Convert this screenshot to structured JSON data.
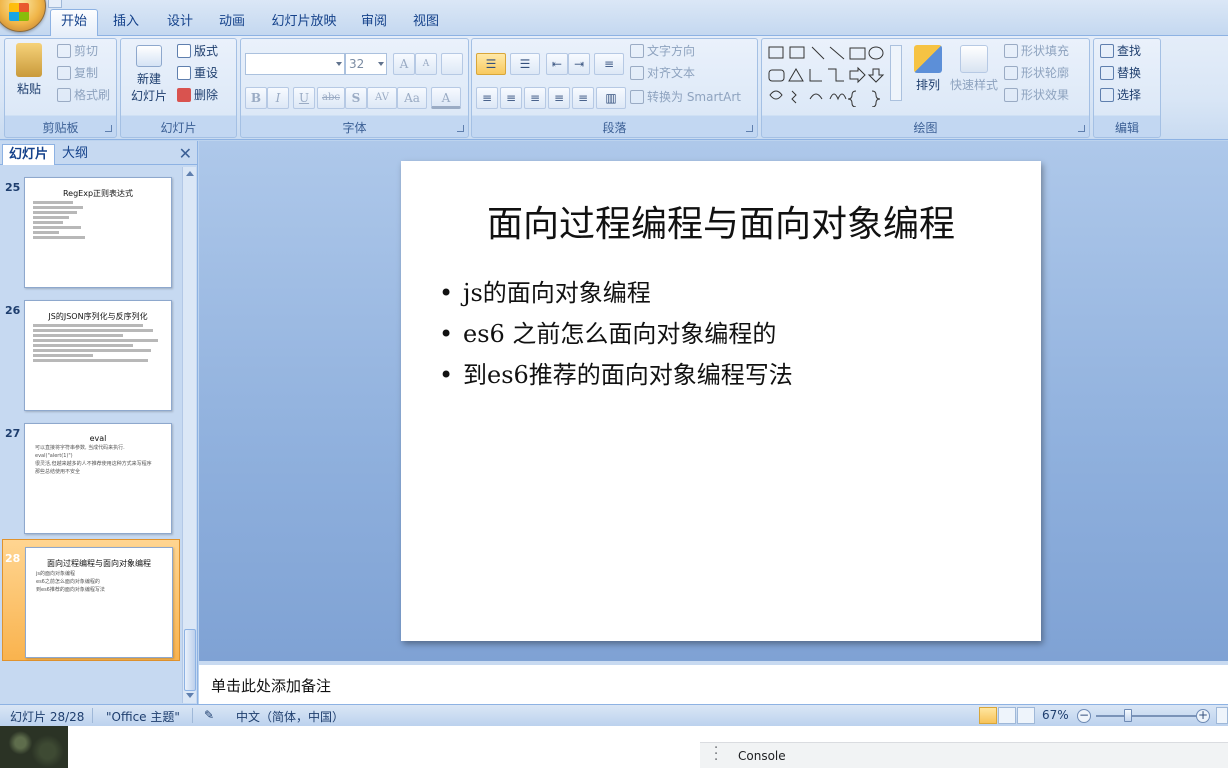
{
  "ribbon_tabs": [
    "开始",
    "插入",
    "设计",
    "动画",
    "幻灯片放映",
    "审阅",
    "视图"
  ],
  "active_tab": "开始",
  "clipboard": {
    "paste": "粘贴",
    "cut": "剪切",
    "copy": "复制",
    "format_painter": "格式刷",
    "label": "剪贴板"
  },
  "slides_group": {
    "new_slide": "新建",
    "new_slide_2": "幻灯片",
    "layout": "版式",
    "reset": "重设",
    "delete": "删除",
    "label": "幻灯片"
  },
  "font": {
    "font_size": "32",
    "bold": "B",
    "italic": "I",
    "underline": "U",
    "strike": "abc",
    "shadow": "S",
    "spacing": "AV",
    "case": "Aa",
    "color": "A",
    "grow": "A",
    "shrink": "A",
    "label": "字体"
  },
  "paragraph": {
    "text_direction": "文字方向",
    "align_text": "对齐文本",
    "smartart": "转换为 SmartArt",
    "label": "段落"
  },
  "drawing": {
    "arrange": "排列",
    "quick_styles": "快速样式",
    "shape_fill": "形状填充",
    "shape_outline": "形状轮廓",
    "shape_effects": "形状效果",
    "label": "绘图"
  },
  "editing": {
    "find": "查找",
    "replace": "替换",
    "select": "选择",
    "label": "编辑"
  },
  "panel_tabs": {
    "slides": "幻灯片",
    "outline": "大纲",
    "close": "✕"
  },
  "thumbnails": [
    {
      "num": "25",
      "title": "RegExp正则表达式"
    },
    {
      "num": "26",
      "title": "JS的JSON序列化与反序列化"
    },
    {
      "num": "27",
      "title": "eval",
      "lines": [
        "可以直接将字符串参数, 当成代码来执行.",
        "eval(\"alert(1)\")",
        "很灵活,但越来越多的人不推荐使用这种方式来写程序",
        "那些总结使用不安全"
      ]
    },
    {
      "num": "28",
      "title": "面向过程编程与面向对象编程",
      "lines": [
        "js的面向对象编程",
        "es6之前怎么面向对象编程的",
        "到es6推荐的面向对象编程写法"
      ]
    }
  ],
  "slide": {
    "title": "面向过程编程与面向对象编程",
    "bullets": [
      "js的面向对象编程",
      "es6 之前怎么面向对象编程的",
      "到es6推荐的面向对象编程写法"
    ]
  },
  "notes_placeholder": "单击此处添加备注",
  "status": {
    "slide_pos": "幻灯片 28/28",
    "theme": "\"Office 主题\"",
    "language": "中文（简体，中国）",
    "zoom": "67%",
    "zoom_level": 0.67
  },
  "console_label": "Console",
  "colors": {
    "ribbon": "#dbe7f6",
    "accent": "#15428b",
    "selected_thumb": "#f9b34e"
  }
}
